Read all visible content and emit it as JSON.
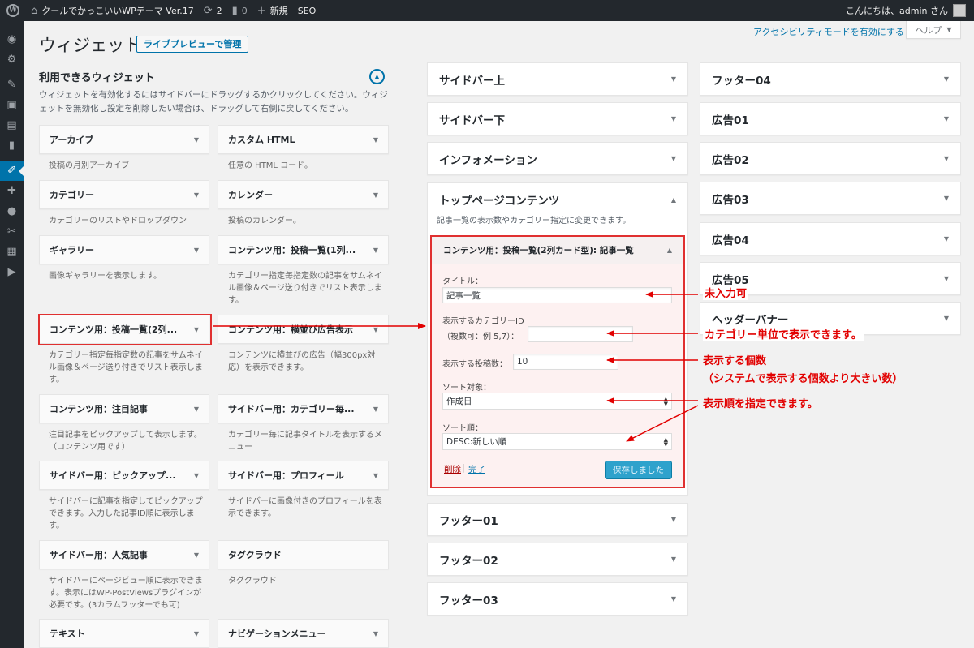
{
  "admin_bar": {
    "site_name": "クールでかっこいいWPテーマ Ver.17",
    "updates_count": "2",
    "comments_count": "0",
    "new_label": "新規",
    "seo_label": "SEO",
    "greeting": "こんにちは、admin さん"
  },
  "admin_menu": [
    "dashboard-icon",
    "gear-icon",
    "pin-icon",
    "media-icon",
    "pages-icon",
    "comments-icon",
    "appearance-icon",
    "plugins-icon",
    "users-icon",
    "tools-icon",
    "settings-icon",
    "play-icon"
  ],
  "header": {
    "title": "ウィジェット",
    "live_preview": "ライブプレビューで管理",
    "a11y_link": "アクセシビリティモードを有効にする",
    "help": "ヘルプ"
  },
  "available": {
    "title": "利用できるウィジェット",
    "description": "ウィジェットを有効化するにはサイドバーにドラッグするかクリックしてください。ウィジェットを無効化し設定を削除したい場合は、ドラッグして右側に戻してください。",
    "widgets": [
      {
        "title": "アーカイブ",
        "desc": "投稿の月別アーカイブ"
      },
      {
        "title": "カスタム HTML",
        "desc": "任意の HTML コード。"
      },
      {
        "title": "カテゴリー",
        "desc": "カテゴリーのリストやドロップダウン"
      },
      {
        "title": "カレンダー",
        "desc": "投稿のカレンダー。"
      },
      {
        "title": "ギャラリー",
        "desc": "画像ギャラリーを表示します。"
      },
      {
        "title": "コンテンツ用：投稿一覧(1列...",
        "desc": "カテゴリー指定毎指定数の記事をサムネイル画像＆ページ送り付きでリスト表示します。"
      },
      {
        "title": "コンテンツ用：投稿一覧(2列...",
        "desc": "カテゴリー指定毎指定数の記事をサムネイル画像＆ページ送り付きでリスト表示します。"
      },
      {
        "title": "コンテンツ用：横並び広告表示",
        "desc": "コンテンツに横並びの広告（幅300px対応）を表示できます。"
      },
      {
        "title": "コンテンツ用：注目記事",
        "desc": "注目記事をピックアップして表示します。（コンテンツ用です）"
      },
      {
        "title": "サイドバー用：カテゴリー毎...",
        "desc": "カテゴリー毎に記事タイトルを表示するメニュー"
      },
      {
        "title": "サイドバー用：ピックアップ...",
        "desc": "サイドバーに記事を指定してピックアップできます。入力した記事ID順に表示します。"
      },
      {
        "title": "サイドバー用：プロフィール",
        "desc": "サイドバーに画像付きのプロフィールを表示できます。"
      },
      {
        "title": "サイドバー用：人気記事",
        "desc": "サイドバーにページビュー順に表示できます。表示にはWP-PostViewsプラグインが必要です。(3カラムフッターでも可)"
      },
      {
        "title": "タグクラウド",
        "desc": "タグクラウド"
      },
      {
        "title": "テキスト",
        "desc": ""
      },
      {
        "title": "ナビゲーションメニュー",
        "desc": ""
      }
    ]
  },
  "sidebars_middle": [
    {
      "title": "サイドバー上"
    },
    {
      "title": "サイドバー下"
    },
    {
      "title": "インフォメーション"
    },
    {
      "title": "フッター01"
    },
    {
      "title": "フッター02"
    },
    {
      "title": "フッター03"
    }
  ],
  "top_page": {
    "title": "トップページコンテンツ",
    "description": "記事一覧の表示数やカテゴリー指定に変更できます。"
  },
  "edit_widget": {
    "title": "コンテンツ用：投稿一覧(2列カード型): 記事一覧",
    "title_label": "タイトル：",
    "title_value": "記事一覧",
    "category_label": "表示するカテゴリーID",
    "category_sublabel": "（複数可：例 5,7）：",
    "category_value": "",
    "count_label": "表示する投稿数：",
    "count_value": "10",
    "sort_label": "ソート対象：",
    "sort_value": "作成日",
    "order_label": "ソート順：",
    "order_value": "DESC:新しい順",
    "delete": "削除",
    "separator": "|",
    "done": "完了",
    "save": "保存しました"
  },
  "sidebars_right": [
    {
      "title": "フッター04"
    },
    {
      "title": "広告01"
    },
    {
      "title": "広告02"
    },
    {
      "title": "広告03"
    },
    {
      "title": "広告04"
    },
    {
      "title": "広告05"
    },
    {
      "title": "ヘッダーバナー"
    }
  ],
  "annotations": {
    "optional": "未入力可",
    "category_unit": "カテゴリー単位で表示できます。",
    "count": "表示する個数",
    "count_note": "（システムで表示する個数より大きい数）",
    "order": "表示順を指定できます。",
    "color": "#e20000"
  }
}
